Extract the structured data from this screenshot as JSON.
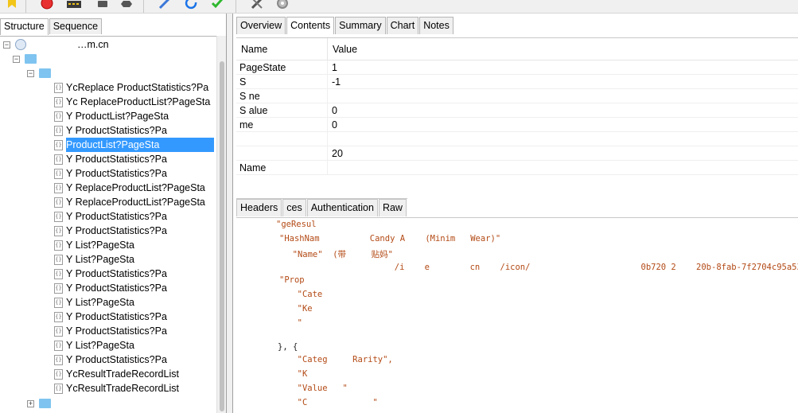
{
  "toolbar": {
    "icons": [
      "tag-icon",
      "record-icon",
      "stream-icon",
      "filter-icon",
      "stop-icon",
      "pencil-icon",
      "refresh-icon",
      "check-icon",
      "tools-icon",
      "gear-icon"
    ]
  },
  "left_tabs": [
    "Structure",
    "Sequence"
  ],
  "tree": {
    "host": "…m.cn",
    "items": [
      "YcReplace ProductStatistics?Pa",
      "Yc  ReplaceProductList?PageSta",
      "Y        ProductList?PageSta",
      "Y       ProductStatistics?Pa",
      "      ProductList?PageSta",
      "Y       ProductStatistics?Pa",
      "Y       ProductStatistics?Pa",
      "Y    ReplaceProductList?PageSta",
      "Y      ReplaceProductList?PageSta",
      "Y       ProductStatistics?Pa",
      "Y       ProductStatistics?Pa",
      "Y            List?PageSta",
      "Y            List?PageSta",
      "Y          ProductStatistics?Pa",
      "Y       ProductStatistics?Pa",
      "Y          List?PageSta",
      "Y         ProductStatistics?Pa",
      "Y          ProductStatistics?Pa",
      "Y            List?PageSta",
      "Y          ProductStatistics?Pa",
      "YcResultTradeRecordList",
      "YcResultTradeRecordList"
    ]
  },
  "right_tabs": [
    "Overview",
    "Contents",
    "Summary",
    "Chart",
    "Notes"
  ],
  "grid": {
    "col_name": "Name",
    "col_value": "Value",
    "rows": [
      {
        "name": "PageState",
        "value": "1"
      },
      {
        "name": "S",
        "value": "-1"
      },
      {
        "name": "S     ne",
        "value": ""
      },
      {
        "name": "S   alue",
        "value": "0"
      },
      {
        "name": "    me",
        "value": "0"
      },
      {
        "name": "",
        "value": ""
      },
      {
        "name": "",
        "value": "20"
      },
      {
        "name": "       Name",
        "value": ""
      }
    ]
  },
  "bottom_tabs": [
    "Headers",
    "                 ces",
    "Authentication",
    "Raw"
  ],
  "raw_lines": [
    "\"geResul",
    "\"HashNam          Candy A    (Minim   Wear)\"",
    "  \"Name\"  (带     贴妈\"",
    "                     /i    e        cn    /icon/                      0b720 2    20b-8fab-7f2704c95a53.png\",",
    "\"Prop",
    "  \"Cate",
    "  \"Ke",
    "  \"",
    "}, {",
    "  \"Categ     Rarity\",",
    "  \"K",
    "  \"Value   \"",
    "  \"C             \""
  ]
}
